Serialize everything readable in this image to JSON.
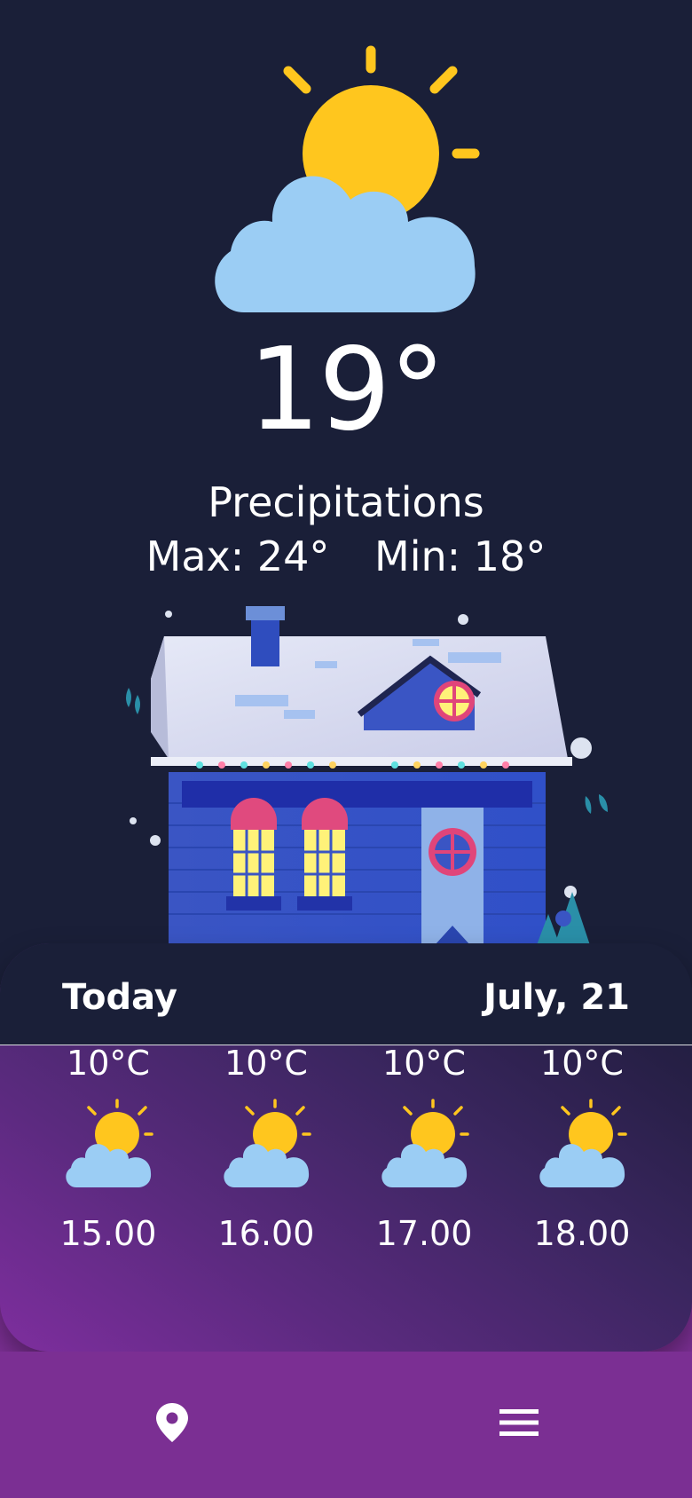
{
  "current": {
    "temperature": "19°",
    "condition": "Precipitations",
    "max": "Max: 24°",
    "min": "Min: 18°",
    "icon": "partly-cloudy-icon"
  },
  "forecast": {
    "title": "Today",
    "date": "July, 21",
    "hours": [
      {
        "temp": "10°C",
        "time": "15.00",
        "icon": "partly-cloudy-icon"
      },
      {
        "temp": "10°C",
        "time": "16.00",
        "icon": "partly-cloudy-icon"
      },
      {
        "temp": "10°C",
        "time": "17.00",
        "icon": "partly-cloudy-icon"
      },
      {
        "temp": "10°C",
        "time": "18.00",
        "icon": "partly-cloudy-icon"
      }
    ]
  },
  "nav": {
    "left_icon": "location-pin-icon",
    "right_icon": "menu-icon"
  },
  "colors": {
    "background": "#1A1F38",
    "sun": "#FFC61E",
    "cloud": "#9BCDF4",
    "accent_purple": "#7B2F93"
  }
}
